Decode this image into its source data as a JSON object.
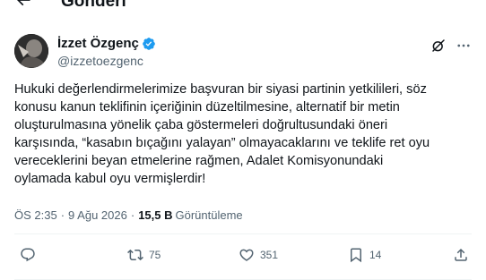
{
  "header": {
    "title": "Gönderi",
    "back_icon": "arrow-left-icon"
  },
  "author": {
    "display_name": "İzzet Özgenç",
    "handle": "@izzetoezgenc",
    "verified": true,
    "verified_color": "#1d9bf0"
  },
  "tweet": {
    "text": "Hukuki değerlendirmelerimize başvuran bir siyasi partinin yetkilileri, söz\nkonusu kanun teklifinin içeriğinin düzeltilmesine, alternatif bir metin\noluşturulmasına yönelik çaba göstermeleri doğrultusundaki öneri\nkarşısında, “kasabın bıçağını yalayan” olmayacaklarını ve teklife ret oyu\nvereceklerini beyan etmelerine rağmen, Adalet Komisyonundaki\noylamada kabul oyu vermişlerdir!"
  },
  "meta": {
    "time": "ÖS 2:35",
    "dot1": "·",
    "date": "9 Ağu 2026",
    "dot2": "·",
    "views_count": "15,5 B",
    "views_label": "Görüntüleme"
  },
  "actions": {
    "reply_count": "",
    "retweet_count": "75",
    "like_count": "351",
    "bookmark_count": "14",
    "share_count": ""
  },
  "colors": {
    "text": "#0f1419",
    "secondary": "#536471",
    "divider": "#eff3f4",
    "accent": "#1d9bf0"
  }
}
